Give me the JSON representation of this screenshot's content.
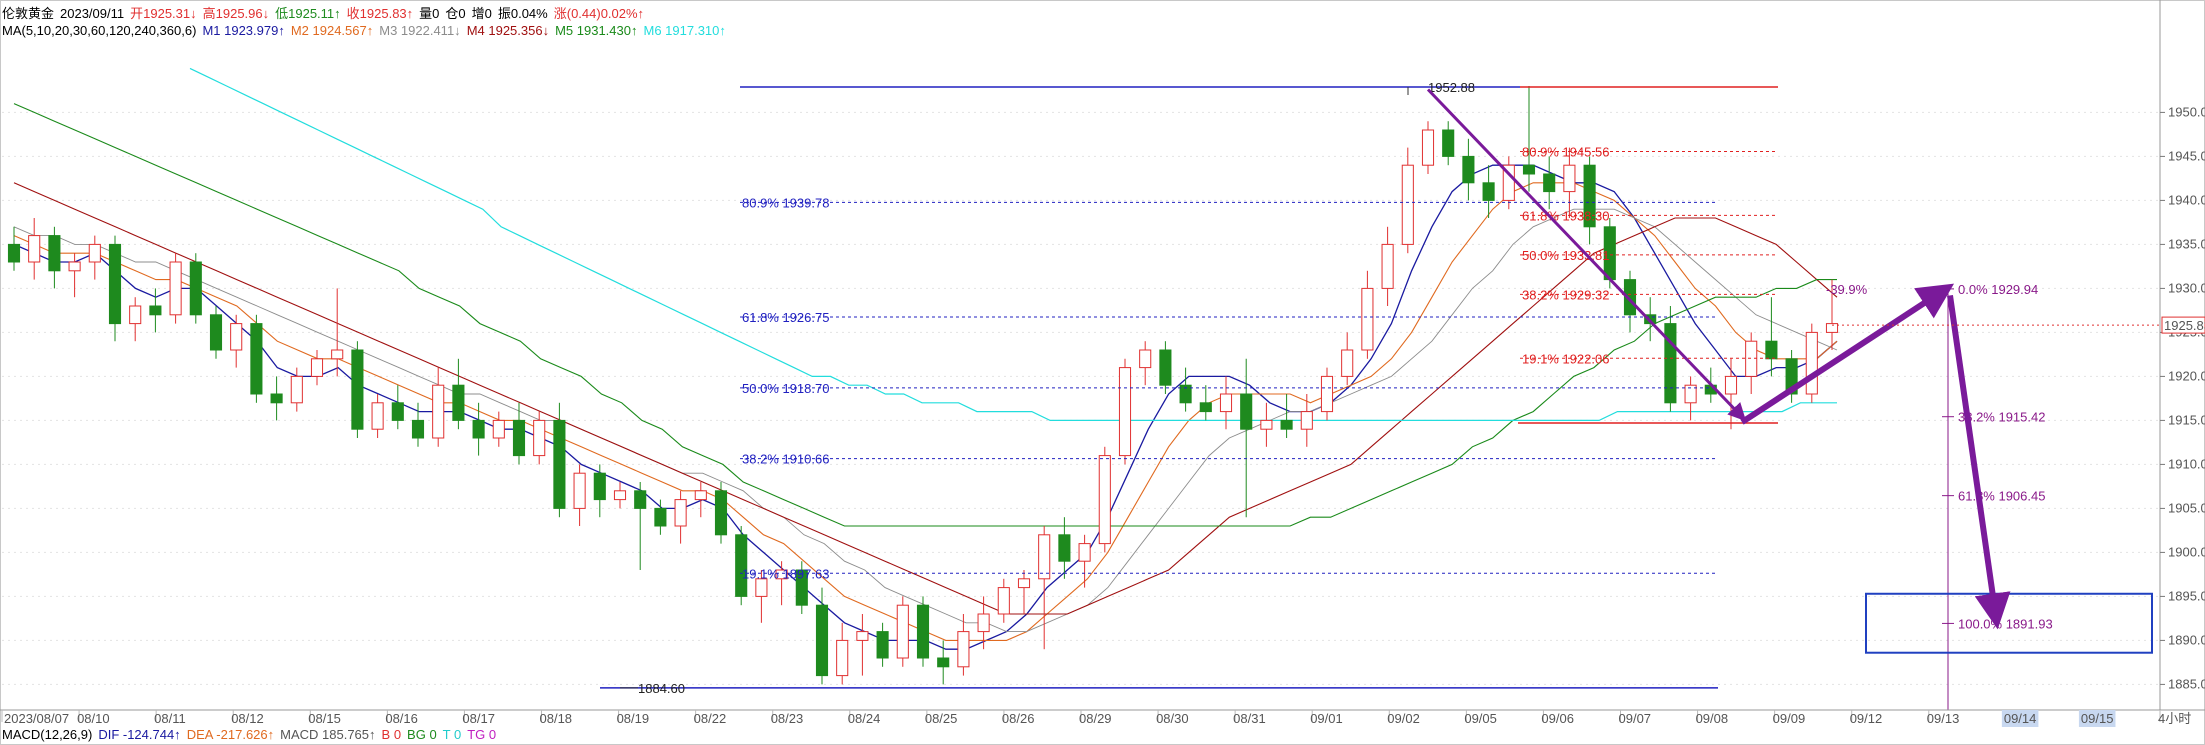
{
  "colors": {
    "up": "#e03030",
    "down": "#1e8a1e",
    "m1": "#1a1aa0",
    "m2": "#e06a20",
    "m3": "#8c8c8c",
    "m4": "#a01010",
    "m5": "#1a8a1a",
    "m6": "#22dddd",
    "fib_blue": "#2020c0",
    "fib_red": "#e02020",
    "fib_purple": "#8a1a8a",
    "arrow": "#7a1a9a"
  },
  "header": {
    "instrument": "伦敦黄金",
    "date": "2023/09/11",
    "open": "开1925.31↓",
    "high": "高1925.96↓",
    "low": "低1925.11↑",
    "close": "收1925.83↑",
    "volume": "量0",
    "position": "仓0",
    "inc": "增0",
    "amplitude": "振0.04%",
    "change": "涨(0.44)0.02%↑"
  },
  "ma_bar": {
    "label": "MA(5,10,20,30,60,120,240,360,6)",
    "m1": "M1 1923.979↑",
    "m2": "M2 1924.567↑",
    "m3": "M3 1922.411↓",
    "m4": "M4 1925.356↓",
    "m5": "M5 1931.430↑",
    "m6": "M6 1917.310↑"
  },
  "macd_bar": {
    "label": "MACD(12,26,9)",
    "dif": "DIF -124.744↑",
    "dea": "DEA -217.626↑",
    "macd": "MACD 185.765↑",
    "b": "B 0",
    "bg": "BG 0",
    "t": "T 0",
    "tg": "TG 0"
  },
  "chart_data": {
    "type": "candlestick",
    "ylim": [
      1883,
      1958
    ],
    "y_ticks": [
      1885.0,
      1890.0,
      1895.0,
      1900.0,
      1905.0,
      1910.0,
      1915.0,
      1920.0,
      1925.0,
      1930.0,
      1935.0,
      1940.0,
      1945.0,
      1950.0
    ],
    "x_labels": [
      "2023/08/07",
      "08/10",
      "08/11",
      "08/12",
      "08/15",
      "08/16",
      "08/17",
      "08/18",
      "08/19",
      "08/22",
      "08/23",
      "08/24",
      "08/25",
      "08/26",
      "08/29",
      "08/30",
      "08/31",
      "09/01",
      "09/02",
      "09/05",
      "09/06",
      "09/07",
      "09/08",
      "09/09",
      "09/12",
      "09/13",
      "09/14",
      "09/15",
      "4小时"
    ],
    "last_price": "1925.83",
    "annotations": {
      "high_label": "1952.88",
      "low_label": "1884.60"
    },
    "fib_left": [
      {
        "label": "80.9% 1939.78",
        "value": 1939.78
      },
      {
        "label": "61.8% 1926.75",
        "value": 1926.75
      },
      {
        "label": "50.0% 1918.70",
        "value": 1918.7
      },
      {
        "label": "38.2% 1910.66",
        "value": 1910.66
      },
      {
        "label": "19.1% 1897.63",
        "value": 1897.63
      }
    ],
    "fib_mid": [
      {
        "label": "80.9% 1945.56",
        "value": 1945.56
      },
      {
        "label": "61.8% 1938.30",
        "value": 1938.3
      },
      {
        "label": "50.0% 1933.81",
        "value": 1933.81
      },
      {
        "label": "38.2% 1929.32",
        "value": 1929.32
      },
      {
        "label": "19.1% 1922.06",
        "value": 1922.06
      }
    ],
    "fib_right": [
      {
        "label": "-39.9%",
        "value": 1929.94
      },
      {
        "label": "0.0% 1929.94",
        "value": 1929.94
      },
      {
        "label": "38.2% 1915.42",
        "value": 1915.42
      },
      {
        "label": "61.8% 1906.45",
        "value": 1906.45
      },
      {
        "label": "100.0% 1891.93",
        "value": 1891.93
      }
    ],
    "candles": [
      [
        1935,
        1937,
        1932,
        1933
      ],
      [
        1933,
        1938,
        1931,
        1936
      ],
      [
        1936,
        1937,
        1930,
        1932
      ],
      [
        1932,
        1934,
        1929,
        1933
      ],
      [
        1933,
        1936,
        1931,
        1935
      ],
      [
        1935,
        1936,
        1924,
        1926
      ],
      [
        1926,
        1929,
        1924,
        1928
      ],
      [
        1928,
        1930,
        1925,
        1927
      ],
      [
        1927,
        1934,
        1926,
        1933
      ],
      [
        1933,
        1934,
        1926,
        1927
      ],
      [
        1927,
        1928,
        1922,
        1923
      ],
      [
        1923,
        1927,
        1921,
        1926
      ],
      [
        1926,
        1927,
        1917,
        1918
      ],
      [
        1918,
        1920,
        1915,
        1917
      ],
      [
        1917,
        1921,
        1916,
        1920
      ],
      [
        1920,
        1923,
        1919,
        1922
      ],
      [
        1922,
        1930,
        1920,
        1923
      ],
      [
        1923,
        1924,
        1913,
        1914
      ],
      [
        1914,
        1918,
        1913,
        1917
      ],
      [
        1917,
        1919,
        1914,
        1915
      ],
      [
        1915,
        1917,
        1912,
        1913
      ],
      [
        1913,
        1921,
        1912,
        1919
      ],
      [
        1919,
        1922,
        1914,
        1915
      ],
      [
        1915,
        1917,
        1911,
        1913
      ],
      [
        1913,
        1916,
        1912,
        1915
      ],
      [
        1915,
        1917,
        1910,
        1911
      ],
      [
        1911,
        1916,
        1910,
        1915
      ],
      [
        1915,
        1917,
        1904,
        1905
      ],
      [
        1905,
        1910,
        1903,
        1909
      ],
      [
        1909,
        1910,
        1904,
        1906
      ],
      [
        1906,
        1908,
        1905,
        1907
      ],
      [
        1907,
        1908,
        1898,
        1905
      ],
      [
        1905,
        1906,
        1902,
        1903
      ],
      [
        1903,
        1907,
        1901,
        1906
      ],
      [
        1906,
        1908,
        1904,
        1907
      ],
      [
        1907,
        1908,
        1901,
        1902
      ],
      [
        1902,
        1903,
        1894,
        1895
      ],
      [
        1895,
        1898,
        1892,
        1897
      ],
      [
        1897,
        1899,
        1894,
        1898
      ],
      [
        1898,
        1899,
        1893,
        1894
      ],
      [
        1894,
        1896,
        1885,
        1886
      ],
      [
        1886,
        1892,
        1885,
        1890
      ],
      [
        1890,
        1893,
        1886,
        1891
      ],
      [
        1891,
        1892,
        1887,
        1888
      ],
      [
        1888,
        1895,
        1887,
        1894
      ],
      [
        1894,
        1895,
        1887,
        1888
      ],
      [
        1888,
        1890,
        1885,
        1887
      ],
      [
        1887,
        1893,
        1886,
        1891
      ],
      [
        1891,
        1895,
        1889,
        1893
      ],
      [
        1893,
        1897,
        1892,
        1896
      ],
      [
        1896,
        1898,
        1893,
        1897
      ],
      [
        1897,
        1903,
        1889,
        1902
      ],
      [
        1902,
        1904,
        1897,
        1899
      ],
      [
        1899,
        1902,
        1896,
        1901
      ],
      [
        1901,
        1912,
        1900,
        1911
      ],
      [
        1911,
        1922,
        1910,
        1921
      ],
      [
        1921,
        1924,
        1919,
        1923
      ],
      [
        1923,
        1924,
        1918,
        1919
      ],
      [
        1919,
        1921,
        1916,
        1917
      ],
      [
        1917,
        1919,
        1915,
        1916
      ],
      [
        1916,
        1920,
        1914,
        1918
      ],
      [
        1918,
        1922,
        1904,
        1914
      ],
      [
        1914,
        1917,
        1912,
        1915
      ],
      [
        1915,
        1918,
        1913,
        1914
      ],
      [
        1914,
        1918,
        1912,
        1916
      ],
      [
        1916,
        1921,
        1915,
        1920
      ],
      [
        1920,
        1925,
        1919,
        1923
      ],
      [
        1923,
        1932,
        1922,
        1930
      ],
      [
        1930,
        1937,
        1928,
        1935
      ],
      [
        1935,
        1946,
        1934,
        1944
      ],
      [
        1944,
        1949,
        1943,
        1948
      ],
      [
        1948,
        1949,
        1944,
        1945
      ],
      [
        1945,
        1947,
        1940,
        1942
      ],
      [
        1942,
        1944,
        1938,
        1940
      ],
      [
        1940,
        1945,
        1939,
        1944
      ],
      [
        1944,
        1953,
        1941,
        1943
      ],
      [
        1943,
        1945,
        1939,
        1941
      ],
      [
        1941,
        1946,
        1938,
        1944
      ],
      [
        1944,
        1945,
        1935,
        1937
      ],
      [
        1937,
        1938,
        1930,
        1931
      ],
      [
        1931,
        1932,
        1925,
        1927
      ],
      [
        1927,
        1929,
        1924,
        1926
      ],
      [
        1926,
        1928,
        1916,
        1917
      ],
      [
        1917,
        1920,
        1915,
        1919
      ],
      [
        1919,
        1921,
        1917,
        1918
      ],
      [
        1918,
        1922,
        1914,
        1920
      ],
      [
        1920,
        1925,
        1918,
        1924
      ],
      [
        1924,
        1929,
        1920,
        1922
      ],
      [
        1922,
        1923,
        1917,
        1918
      ],
      [
        1918,
        1926,
        1917,
        1925
      ],
      [
        1925,
        1931,
        1923,
        1926
      ]
    ],
    "series": [
      {
        "name": "M1",
        "values": [
          1935,
          1934,
          1933,
          1933,
          1934,
          1932,
          1930,
          1929,
          1930,
          1930,
          1928,
          1926,
          1924,
          1921,
          1920,
          1920,
          1921,
          1919,
          1918,
          1917,
          1916,
          1916,
          1916,
          1915,
          1914,
          1914,
          1913,
          1912,
          1910,
          1909,
          1908,
          1907,
          1905,
          1905,
          1906,
          1905,
          1902,
          1900,
          1898,
          1896,
          1894,
          1892,
          1891,
          1890,
          1890,
          1890,
          1889,
          1889,
          1890,
          1891,
          1893,
          1896,
          1898,
          1900,
          1904,
          1909,
          1914,
          1918,
          1920,
          1920,
          1920,
          1919,
          1917,
          1916,
          1916,
          1917,
          1919,
          1922,
          1926,
          1932,
          1937,
          1941,
          1943,
          1944,
          1944,
          1944,
          1943,
          1942,
          1942,
          1941,
          1938,
          1934,
          1930,
          1926,
          1923,
          1920,
          1920,
          1921,
          1921,
          1922,
          1924
        ]
      },
      {
        "name": "M2",
        "values": [
          1936,
          1935,
          1934,
          1934,
          1934,
          1933,
          1932,
          1931,
          1931,
          1930,
          1929,
          1928,
          1926,
          1924,
          1923,
          1922,
          1922,
          1921,
          1920,
          1919,
          1918,
          1917,
          1917,
          1916,
          1915,
          1915,
          1914,
          1913,
          1912,
          1911,
          1910,
          1909,
          1908,
          1907,
          1907,
          1906,
          1904,
          1902,
          1901,
          1899,
          1897,
          1895,
          1894,
          1893,
          1892,
          1891,
          1890,
          1890,
          1890,
          1890,
          1891,
          1893,
          1895,
          1897,
          1900,
          1904,
          1908,
          1912,
          1915,
          1917,
          1918,
          1918,
          1918,
          1918,
          1917,
          1918,
          1919,
          1920,
          1922,
          1925,
          1929,
          1933,
          1936,
          1939,
          1941,
          1942,
          1942,
          1942,
          1941,
          1940,
          1938,
          1936,
          1933,
          1930,
          1928,
          1925,
          1923,
          1922,
          1922,
          1922,
          1924
        ]
      },
      {
        "name": "M3",
        "values": [
          1937,
          1936,
          1936,
          1935,
          1935,
          1934,
          1933,
          1933,
          1932,
          1931,
          1930,
          1929,
          1928,
          1927,
          1926,
          1925,
          1924,
          1923,
          1922,
          1921,
          1920,
          1919,
          1918,
          1918,
          1917,
          1916,
          1915,
          1915,
          1914,
          1913,
          1912,
          1911,
          1910,
          1909,
          1909,
          1908,
          1907,
          1905,
          1904,
          1902,
          1901,
          1899,
          1898,
          1896,
          1895,
          1894,
          1893,
          1892,
          1892,
          1891,
          1891,
          1892,
          1893,
          1894,
          1896,
          1899,
          1902,
          1905,
          1908,
          1911,
          1913,
          1914,
          1915,
          1916,
          1916,
          1917,
          1918,
          1919,
          1920,
          1922,
          1924,
          1927,
          1930,
          1932,
          1935,
          1937,
          1938,
          1939,
          1939,
          1939,
          1938,
          1937,
          1935,
          1933,
          1931,
          1929,
          1927,
          1926,
          1925,
          1924,
          1923
        ]
      },
      {
        "name": "M4",
        "values": [
          1942,
          1941,
          1940,
          1939,
          1938,
          1937,
          1936,
          1935,
          1934,
          1933,
          1932,
          1931,
          1930,
          1929,
          1928,
          1927,
          1926,
          1925,
          1924,
          1923,
          1922,
          1921,
          1920,
          1919,
          1918,
          1917,
          1916,
          1915,
          1914,
          1913,
          1912,
          1911,
          1910,
          1909,
          1908,
          1907,
          1906,
          1905,
          1904,
          1903,
          1902,
          1901,
          1900,
          1899,
          1898,
          1897,
          1896,
          1895,
          1894,
          1893,
          1893,
          1893,
          1893,
          1894,
          1895,
          1896,
          1897,
          1898,
          1900,
          1902,
          1904,
          1905,
          1906,
          1907,
          1908,
          1909,
          1910,
          1912,
          1914,
          1916,
          1918,
          1920,
          1922,
          1924,
          1926,
          1928,
          1930,
          1932,
          1934,
          1935,
          1936,
          1937,
          1938,
          1938,
          1938,
          1937,
          1936,
          1935,
          1933,
          1931,
          1929
        ]
      },
      {
        "name": "M5",
        "values": [
          1951,
          1950,
          1949,
          1948,
          1947,
          1946,
          1945,
          1944,
          1943,
          1942,
          1941,
          1940,
          1939,
          1938,
          1937,
          1936,
          1935,
          1934,
          1933,
          1932,
          1930,
          1929,
          1928,
          1926,
          1925,
          1924,
          1922,
          1921,
          1920,
          1918,
          1917,
          1915,
          1914,
          1912,
          1911,
          1910,
          1908,
          1907,
          1906,
          1905,
          1904,
          1903,
          1903,
          1903,
          1903,
          1903,
          1903,
          1903,
          1903,
          1903,
          1903,
          1903,
          1903,
          1903,
          1903,
          1903,
          1903,
          1903,
          1903,
          1903,
          1903,
          1903,
          1903,
          1903,
          1904,
          1904,
          1905,
          1906,
          1907,
          1908,
          1909,
          1910,
          1912,
          1913,
          1915,
          1916,
          1918,
          1920,
          1921,
          1923,
          1924,
          1926,
          1927,
          1928,
          1929,
          1929,
          1929,
          1930,
          1930,
          1931,
          1931
        ]
      },
      {
        "name": "M6",
        "values": [
          1955,
          1954,
          1953,
          1952,
          1951,
          1950,
          1949,
          1948,
          1947,
          1946,
          1945,
          1944,
          1943,
          1942,
          1941,
          1940,
          1939,
          1937,
          1936,
          1935,
          1934,
          1933,
          1932,
          1931,
          1930,
          1929,
          1928,
          1927,
          1926,
          1925,
          1924,
          1923,
          1922,
          1921,
          1920,
          1920,
          1919,
          1919,
          1918,
          1918,
          1917,
          1917,
          1917,
          1916,
          1916,
          1916,
          1916,
          1915,
          1915,
          1915,
          1915,
          1915,
          1915,
          1915,
          1915,
          1915,
          1915,
          1915,
          1915,
          1915,
          1915,
          1915,
          1915,
          1915,
          1915,
          1915,
          1915,
          1915,
          1915,
          1915,
          1915,
          1915,
          1915,
          1915,
          1915,
          1915,
          1915,
          1915,
          1916,
          1916,
          1916,
          1916,
          1916,
          1916,
          1916,
          1916,
          1916,
          1916,
          1917,
          1917,
          1917
        ]
      }
    ]
  }
}
